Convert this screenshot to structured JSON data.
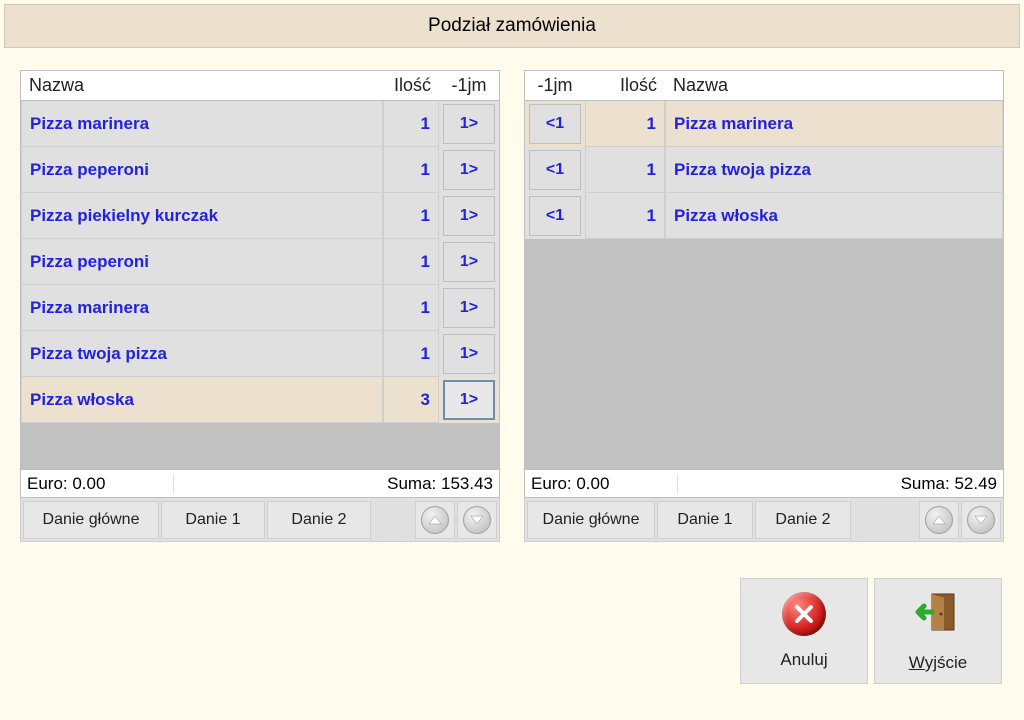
{
  "title": "Podział zamówienia",
  "headers": {
    "name": "Nazwa",
    "qty": "Ilość",
    "move_right": "-1jm",
    "move_left": "-1jm"
  },
  "left": {
    "rows": [
      {
        "name": "Pizza marinera",
        "qty": 1,
        "move": "1>",
        "highlight": false
      },
      {
        "name": "Pizza peperoni",
        "qty": 1,
        "move": "1>",
        "highlight": false
      },
      {
        "name": "Pizza piekielny kurczak",
        "qty": 1,
        "move": "1>",
        "highlight": false
      },
      {
        "name": "Pizza peperoni",
        "qty": 1,
        "move": "1>",
        "highlight": false
      },
      {
        "name": "Pizza marinera",
        "qty": 1,
        "move": "1>",
        "highlight": false
      },
      {
        "name": "Pizza twoja pizza",
        "qty": 1,
        "move": "1>",
        "highlight": false
      },
      {
        "name": "Pizza włoska",
        "qty": 3,
        "move": "1>",
        "highlight": true
      }
    ],
    "euro": "Euro: 0.00",
    "sum": "Suma: 153.43"
  },
  "right": {
    "rows": [
      {
        "name": "Pizza marinera",
        "qty": 1,
        "move": "<1",
        "highlight": true
      },
      {
        "name": "Pizza twoja pizza",
        "qty": 1,
        "move": "<1",
        "highlight": false
      },
      {
        "name": "Pizza włoska",
        "qty": 1,
        "move": "<1",
        "highlight": false
      }
    ],
    "euro": "Euro: 0.00",
    "sum": "Suma: 52.49"
  },
  "tabs": {
    "main": "Danie główne",
    "d1": "Danie 1",
    "d2": "Danie 2"
  },
  "buttons": {
    "cancel": "Anuluj",
    "exit_pre": "W",
    "exit_post": "yjście"
  }
}
